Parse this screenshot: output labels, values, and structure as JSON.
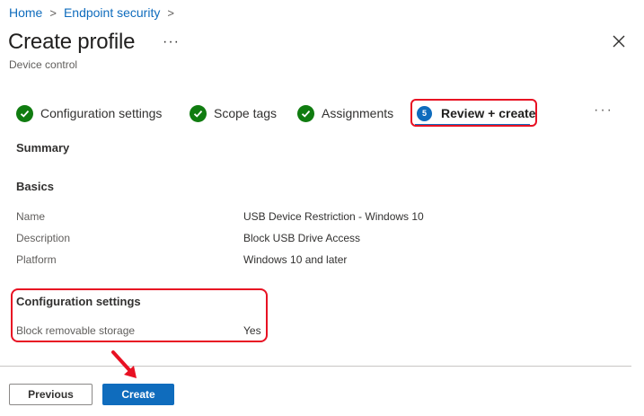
{
  "breadcrumb": {
    "items": [
      "Home",
      "Endpoint security"
    ],
    "separator": ">"
  },
  "header": {
    "title": "Create profile",
    "more_label": "···",
    "subtitle": "Device control",
    "close_icon": "close-icon"
  },
  "tabs": [
    {
      "label": "Configuration settings",
      "status": "complete",
      "icon": "check-circle-icon"
    },
    {
      "label": "Scope tags",
      "status": "complete",
      "icon": "check-circle-icon"
    },
    {
      "label": "Assignments",
      "status": "complete",
      "icon": "check-circle-icon"
    },
    {
      "label": "Review + create",
      "status": "active",
      "step": "5"
    }
  ],
  "tabs_more_label": "···",
  "summary": {
    "heading": "Summary",
    "basics": {
      "heading": "Basics",
      "rows": [
        {
          "label": "Name",
          "value": "USB Device Restriction - Windows 10"
        },
        {
          "label": "Description",
          "value": "Block USB Drive Access"
        },
        {
          "label": "Platform",
          "value": "Windows 10 and later"
        }
      ]
    },
    "configuration": {
      "heading": "Configuration settings",
      "rows": [
        {
          "label": "Block removable storage",
          "value": "Yes"
        }
      ]
    }
  },
  "footer": {
    "previous_label": "Previous",
    "create_label": "Create"
  },
  "colors": {
    "accent": "#0f6cbd",
    "success": "#107c10",
    "highlight": "#e81123"
  }
}
